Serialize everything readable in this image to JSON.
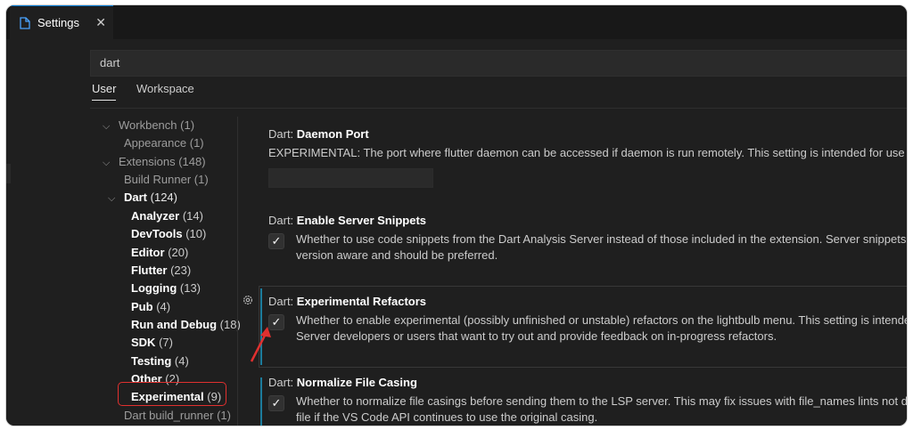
{
  "tab": {
    "title": "Settings",
    "close": "✕",
    "icon": "file-icon"
  },
  "search": {
    "value": "dart"
  },
  "scopes": [
    {
      "label": "User",
      "active": true
    },
    {
      "label": "Workspace",
      "active": false
    }
  ],
  "toc": [
    {
      "label": "Workbench",
      "count": "(1)",
      "chev": "⌵"
    },
    {
      "label": "Appearance",
      "count": "(1)"
    },
    {
      "label": "Extensions",
      "count": "(148)",
      "chev": "⌵"
    },
    {
      "label": "Build Runner",
      "count": "(1)"
    },
    {
      "label": "Dart",
      "count": "(124)",
      "chev": "⌵"
    },
    {
      "label": "Analyzer",
      "count": "(14)"
    },
    {
      "label": "DevTools",
      "count": "(10)"
    },
    {
      "label": "Editor",
      "count": "(20)"
    },
    {
      "label": "Flutter",
      "count": "(23)"
    },
    {
      "label": "Logging",
      "count": "(13)"
    },
    {
      "label": "Pub",
      "count": "(4)"
    },
    {
      "label": "Run and Debug",
      "count": "(18)"
    },
    {
      "label": "SDK",
      "count": "(7)"
    },
    {
      "label": "Testing",
      "count": "(4)"
    },
    {
      "label": "Other",
      "count": "(2)"
    },
    {
      "label": "Experimental",
      "count": "(9)"
    },
    {
      "label": "Dart build_runner",
      "count": "(1)"
    }
  ],
  "settings": [
    {
      "category": "Dart: ",
      "name": "Daemon Port",
      "desc": "EXPERIMENTAL: The port where flutter daemon can be accessed if daemon is run remotely. This setting is intended for use by Go"
    },
    {
      "category": "Dart: ",
      "name": "Enable Server Snippets",
      "checked": "✓",
      "desc1": "Whether to use code snippets from the Dart Analysis Server instead of those included in the extension. Server snippets are c",
      "desc2": "version aware and should be preferred."
    },
    {
      "category": "Dart: ",
      "name": "Experimental Refactors",
      "checked": "✓",
      "desc1": "Whether to enable experimental (possibly unfinished or unstable) refactors on the lightbulb menu. This setting is intended fo",
      "desc2": "Server developers or users that want to try out and provide feedback on in-progress refactors."
    },
    {
      "category": "Dart: ",
      "name": "Normalize File Casing",
      "checked": "✓",
      "desc1": "Whether to normalize file casings before sending them to the LSP server. This may fix issues with file_names lints not disapp",
      "desc2": "file if the VS Code API continues to use the original casing."
    }
  ],
  "colors": {
    "accent": "#0078d4",
    "highlight": "#e0302f",
    "modified": "#1c7c9c"
  }
}
